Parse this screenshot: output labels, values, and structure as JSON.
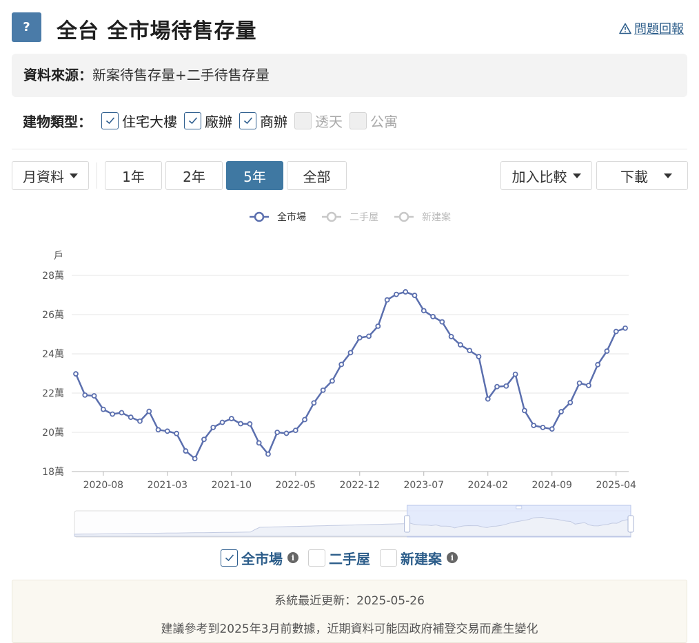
{
  "header": {
    "help_label": "?",
    "title": "全台 全市場待售存量",
    "report_icon": "warning-triangle-icon",
    "report_label": "問題回報"
  },
  "source": {
    "label": "資料來源：",
    "value": "新案待售存量+二手待售存量"
  },
  "building_types": {
    "label": "建物類型：",
    "items": [
      {
        "label": "住宅大樓",
        "checked": true
      },
      {
        "label": "廠辦",
        "checked": true
      },
      {
        "label": "商辦",
        "checked": true
      },
      {
        "label": "透天",
        "checked": false
      },
      {
        "label": "公寓",
        "checked": false
      }
    ]
  },
  "controls": {
    "interval_label": "月資料",
    "ranges": [
      "1年",
      "2年",
      "5年",
      "全部"
    ],
    "active_range": "5年",
    "compare_label": "加入比較",
    "download_label": "下載"
  },
  "series_toggles": [
    {
      "label": "全市場",
      "checked": true,
      "info": true
    },
    {
      "label": "二手屋",
      "checked": false,
      "info": false
    },
    {
      "label": "新建案",
      "checked": false,
      "info": true
    }
  ],
  "footer": {
    "updated": "系統最近更新：2025-05-26",
    "note": "建議參考到2025年3月前數據，近期資料可能因政府補登交易而產生變化"
  },
  "colors": {
    "accent": "#3f78a2",
    "line": "#5b6fae",
    "legend_inactive": "#c8c8c8"
  },
  "chart_data": {
    "type": "line",
    "unit_label": "戶",
    "y_tick_labels": [
      "18萬",
      "20萬",
      "22萬",
      "24萬",
      "26萬",
      "28萬"
    ],
    "y_ticks": [
      180000,
      200000,
      220000,
      240000,
      260000,
      280000
    ],
    "ylim": [
      180000,
      280000
    ],
    "x_tick_labels": [
      "2020-08",
      "2021-03",
      "2021-10",
      "2022-05",
      "2022-12",
      "2023-07",
      "2024-02",
      "2024-09",
      "2025-04"
    ],
    "grid": true,
    "legend": [
      {
        "name": "全市場",
        "active": true
      },
      {
        "name": "二手屋",
        "active": false
      },
      {
        "name": "新建案",
        "active": false
      }
    ],
    "legend_position": "top-center",
    "x": [
      "2020-05",
      "2020-06",
      "2020-07",
      "2020-08",
      "2020-09",
      "2020-10",
      "2020-11",
      "2020-12",
      "2021-01",
      "2021-02",
      "2021-03",
      "2021-04",
      "2021-05",
      "2021-06",
      "2021-07",
      "2021-08",
      "2021-09",
      "2021-10",
      "2021-11",
      "2021-12",
      "2022-01",
      "2022-02",
      "2022-03",
      "2022-04",
      "2022-05",
      "2022-06",
      "2022-07",
      "2022-08",
      "2022-09",
      "2022-10",
      "2022-11",
      "2022-12",
      "2023-01",
      "2023-02",
      "2023-03",
      "2023-04",
      "2023-05",
      "2023-06",
      "2023-07",
      "2023-08",
      "2023-09",
      "2023-10",
      "2023-11",
      "2023-12",
      "2024-01",
      "2024-02",
      "2024-03",
      "2024-04",
      "2024-05",
      "2024-06",
      "2024-07",
      "2024-08",
      "2024-09",
      "2024-10",
      "2024-11",
      "2024-12",
      "2025-01",
      "2025-02",
      "2025-03",
      "2025-04",
      "2025-05"
    ],
    "series": [
      {
        "name": "全市場",
        "values": [
          229800,
          219000,
          218600,
          211700,
          209300,
          210000,
          207700,
          205700,
          210700,
          201300,
          200600,
          199400,
          190500,
          186600,
          196400,
          202500,
          205100,
          207000,
          204400,
          204300,
          194600,
          188900,
          200000,
          199500,
          201000,
          206500,
          215000,
          221500,
          226200,
          234600,
          240600,
          248200,
          249000,
          254100,
          267500,
          270300,
          271600,
          269800,
          262000,
          259000,
          256300,
          248800,
          244600,
          241700,
          238600,
          217000,
          223300,
          223600,
          229600,
          211100,
          203500,
          202500,
          201700,
          210500,
          215200,
          225100,
          223900,
          234500,
          241400,
          251400,
          253100
        ]
      }
    ]
  }
}
